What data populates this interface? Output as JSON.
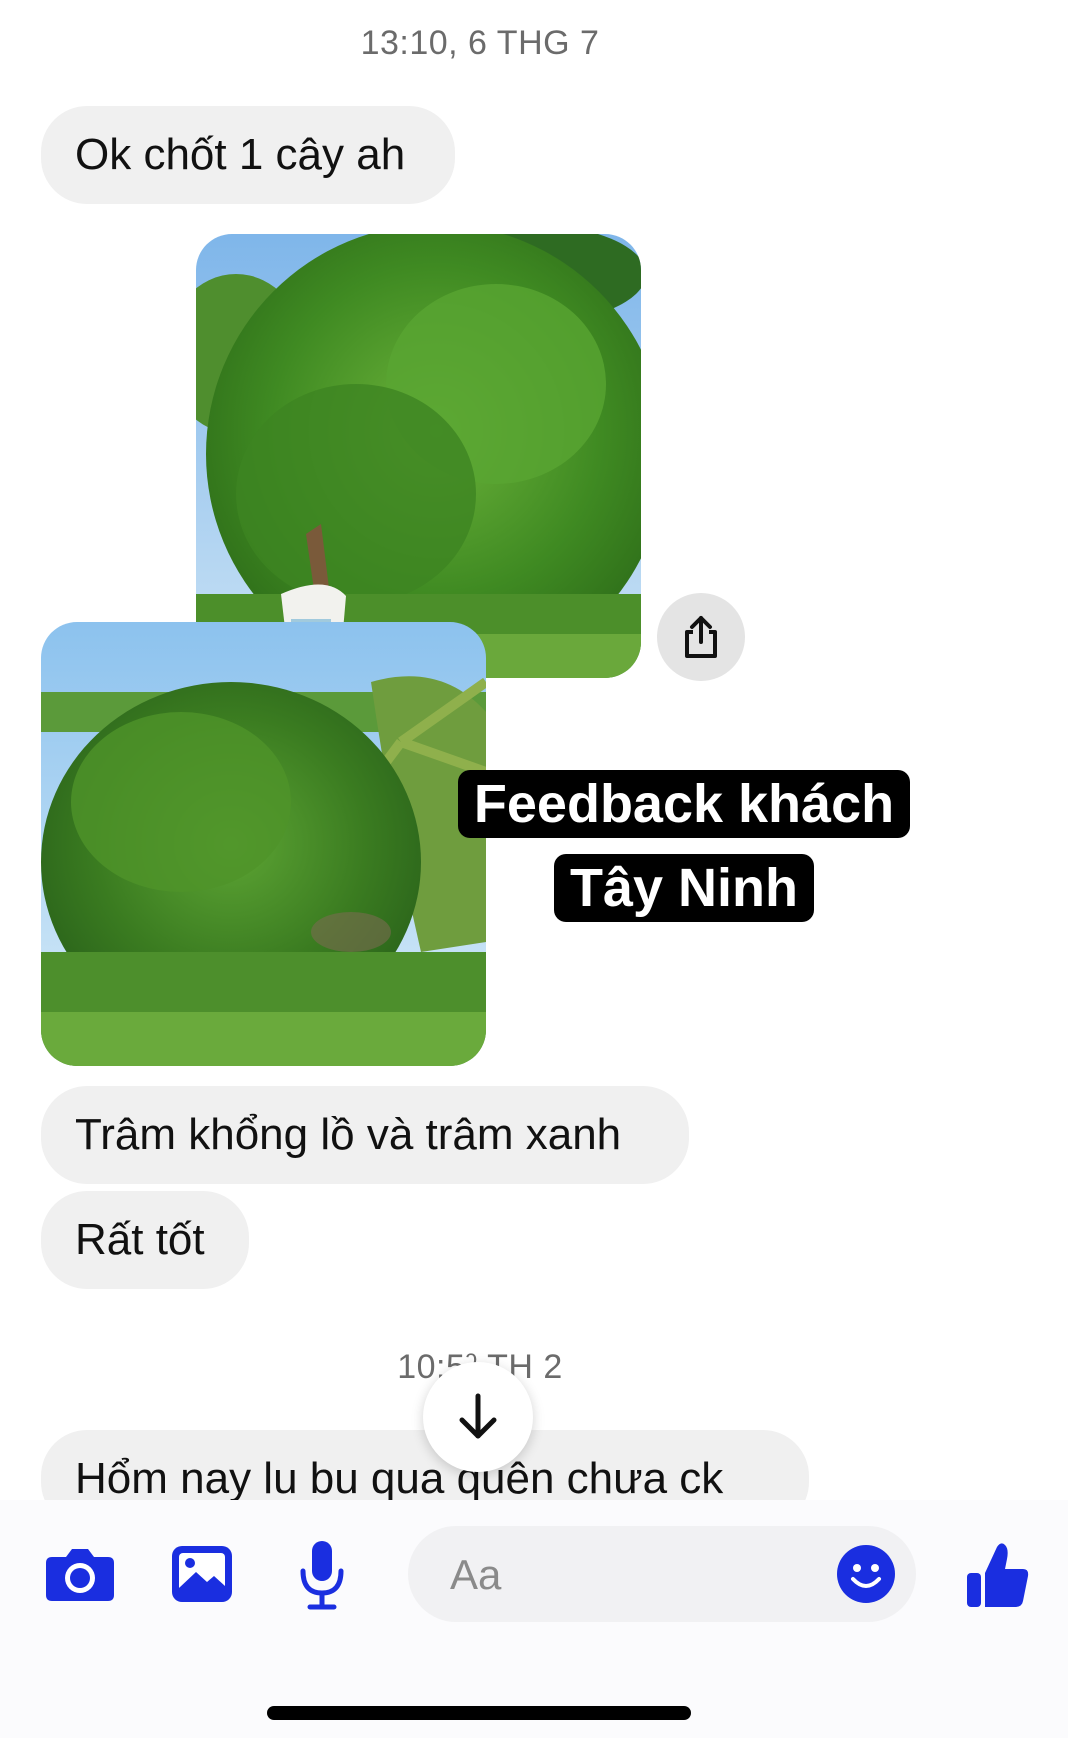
{
  "timestamps": {
    "first": "13:10, 6 THG 7",
    "second": "10:5ˀ TH 2"
  },
  "messages": {
    "m1": "Ok chốt 1 cây ah",
    "m2": "Trâm khổng lồ và trâm xanh",
    "m3": "Rất tốt",
    "m4": "Hổm nay lu bu qua quên chưa ck"
  },
  "caption": {
    "line1": "Feedback khách",
    "line2": "Tây Ninh"
  },
  "composer": {
    "placeholder": "Aa"
  },
  "icons": {
    "share": "share-icon",
    "scroll_down": "arrow-down-icon",
    "camera": "camera-icon",
    "gallery": "gallery-icon",
    "mic": "microphone-icon",
    "emoji": "emoji-icon",
    "like": "thumbs-up-icon"
  },
  "colors": {
    "accent": "#1a2ee0",
    "bubble": "#f0f0f0",
    "caption_bg": "#000000"
  }
}
